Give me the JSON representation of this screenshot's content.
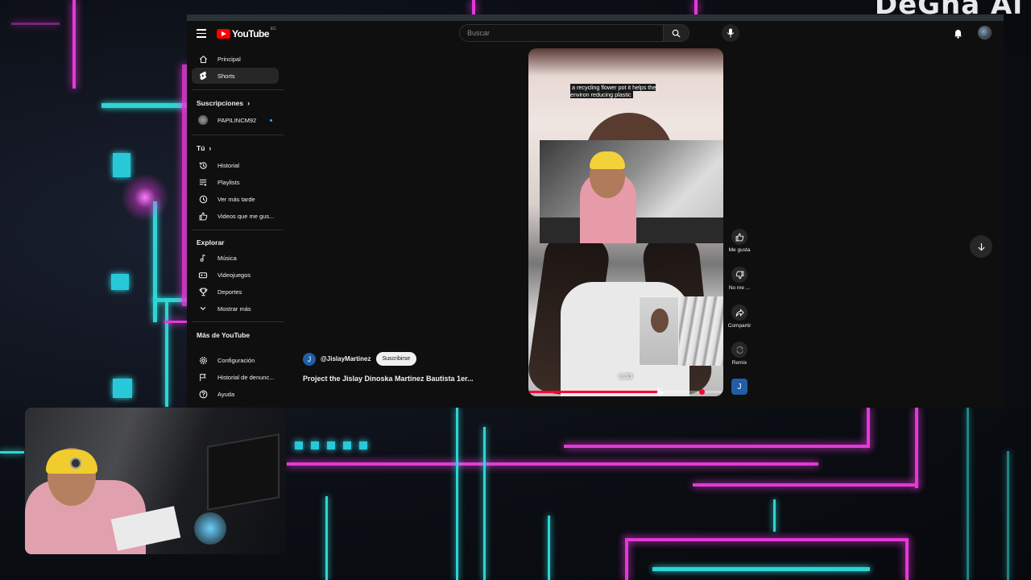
{
  "header": {
    "logo_text": "YouTube",
    "logo_country": "EC",
    "search_placeholder": "Buscar"
  },
  "sidebar": {
    "main": [
      {
        "label": "Principal",
        "icon": "home-icon"
      },
      {
        "label": "Shorts",
        "icon": "shorts-icon",
        "active": true
      }
    ],
    "subscriptions_heading": "Suscripciones",
    "subscriptions": [
      {
        "label": "PAPILINCM92",
        "live": true
      }
    ],
    "you_heading": "Tú",
    "you": [
      {
        "label": "Historial",
        "icon": "history-icon"
      },
      {
        "label": "Playlists",
        "icon": "playlists-icon"
      },
      {
        "label": "Ver más tarde",
        "icon": "watch-later-icon"
      },
      {
        "label": "Videos que me gus...",
        "icon": "liked-videos-icon"
      }
    ],
    "explore_heading": "Explorar",
    "explore": [
      {
        "label": "Música",
        "icon": "music-icon"
      },
      {
        "label": "Videojuegos",
        "icon": "gaming-icon"
      },
      {
        "label": "Deportes",
        "icon": "trophy-icon"
      },
      {
        "label": "Mostrar más",
        "icon": "chevron-down-icon"
      }
    ],
    "more_heading": "Más de YouTube",
    "footer": [
      {
        "label": "Configuración",
        "icon": "gear-icon"
      },
      {
        "label": "Historial de denunc...",
        "icon": "flag-icon"
      },
      {
        "label": "Ayuda",
        "icon": "help-icon"
      }
    ]
  },
  "short": {
    "caption": "a recycling flower pot it helps the environ reducing plastic",
    "timestamp": "0:33",
    "progress_played": 0.67,
    "progress_knob": 0.89,
    "channel_initial": "J",
    "channel_handle": "@JislayMartinez",
    "subscribe_label": "Suscribirse",
    "title": "Project the Jislay Dinoska Martinez Bautista 1er...",
    "actions": {
      "like": "Me gusta",
      "dislike": "No me ...",
      "share": "Compartir",
      "remix": "Remix"
    }
  },
  "overlay": {
    "corner_text": "DeGha Al"
  },
  "colors": {
    "accent_red": "#ff0033",
    "channel_blue": "#1f5fa8",
    "neon_pink": "#e23ad6",
    "neon_cyan": "#2fd4d4"
  }
}
